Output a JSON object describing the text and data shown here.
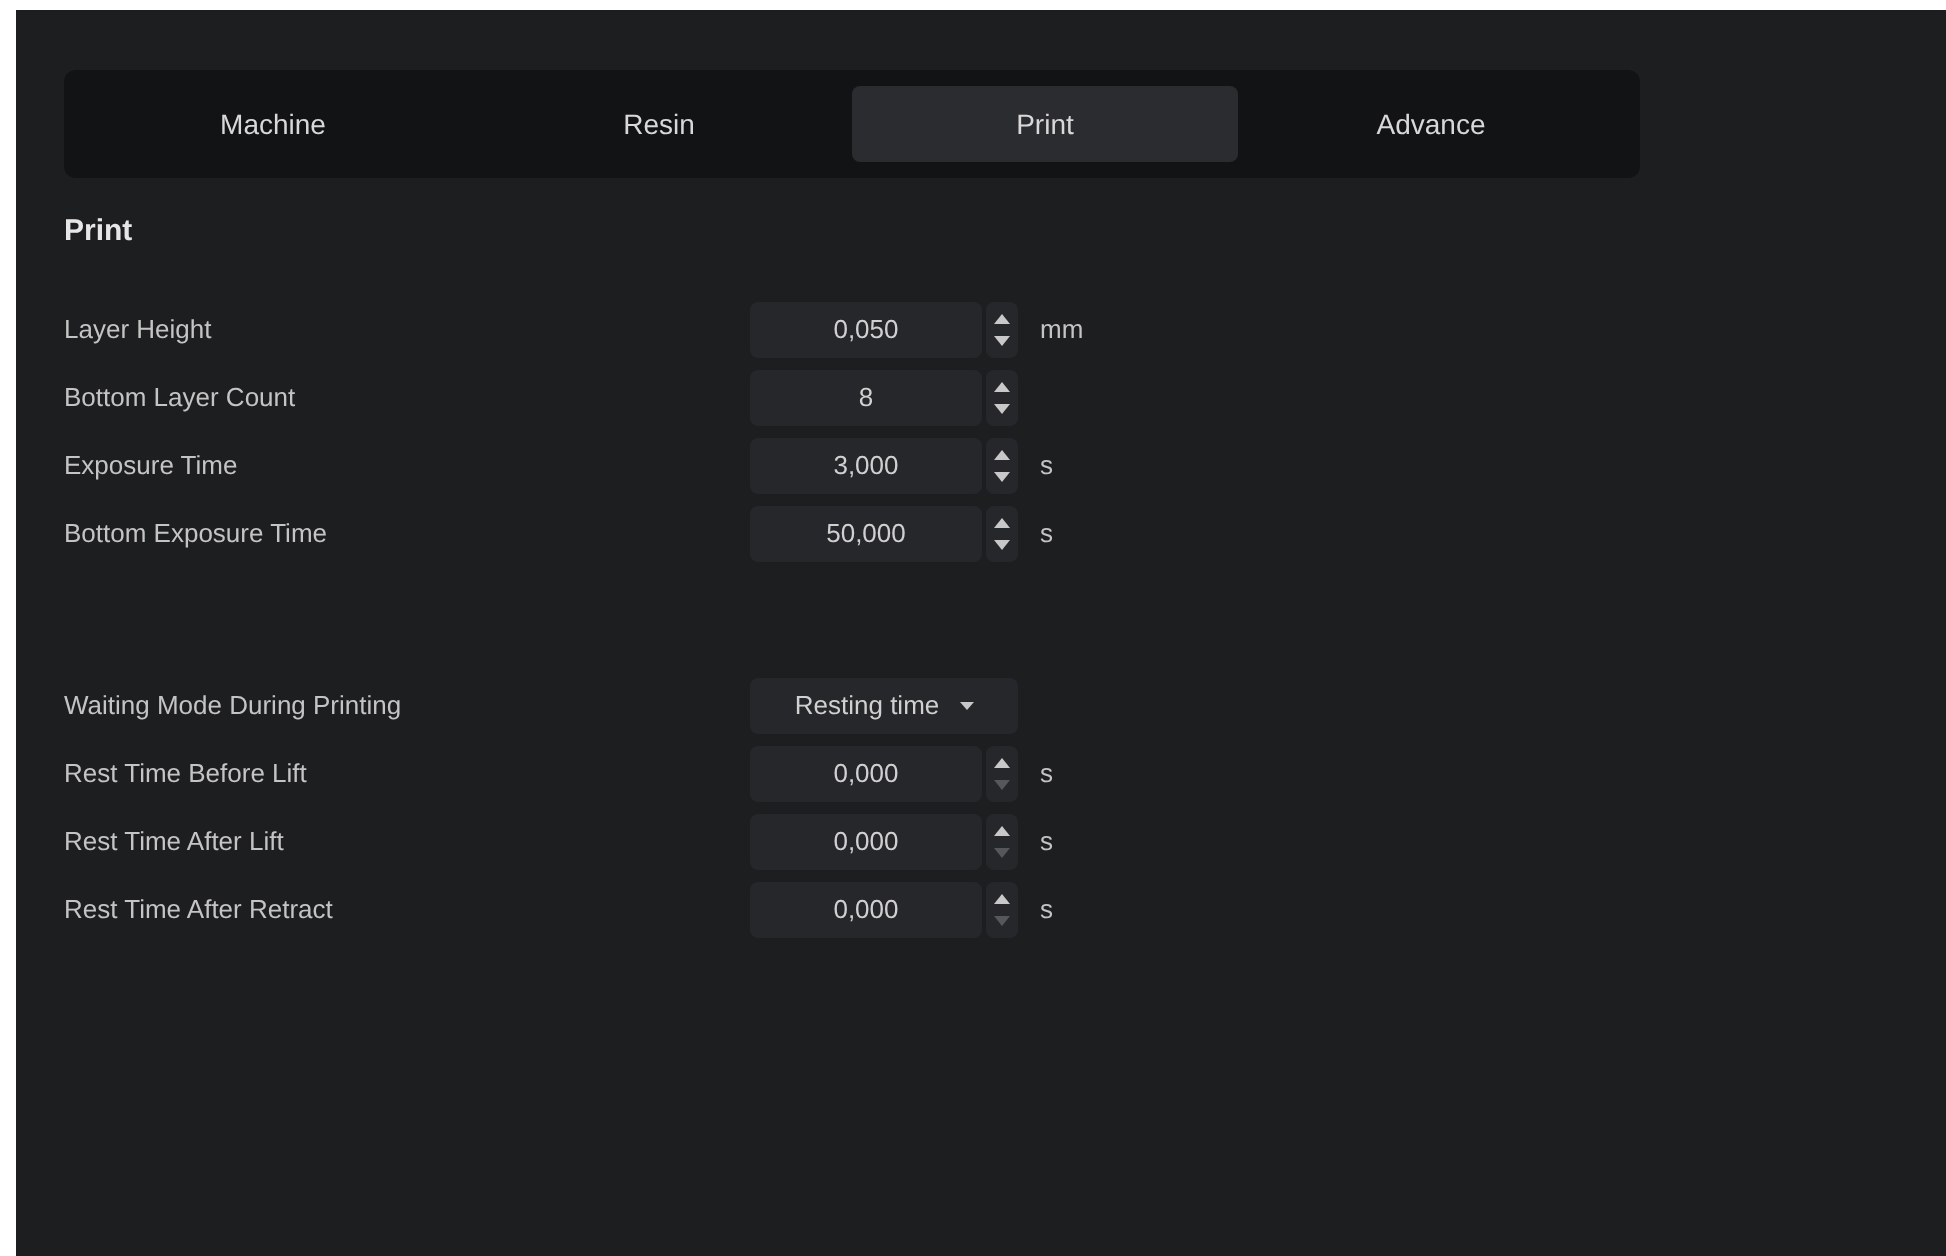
{
  "tabs": [
    {
      "label": "Machine",
      "selected": false
    },
    {
      "label": "Resin",
      "selected": false
    },
    {
      "label": "Print",
      "selected": true
    },
    {
      "label": "Advance",
      "selected": false
    }
  ],
  "section_title": "Print",
  "groups": [
    {
      "rows": [
        {
          "kind": "spin",
          "label": "Layer Height",
          "value": "0,050",
          "unit": "mm",
          "down_disabled": false
        },
        {
          "kind": "spin",
          "label": "Bottom Layer Count",
          "value": "8",
          "down_disabled": false
        },
        {
          "kind": "spin",
          "label": "Exposure Time",
          "value": "3,000",
          "unit": "s",
          "down_disabled": false
        },
        {
          "kind": "spin",
          "label": "Bottom Exposure Time",
          "value": "50,000",
          "unit": "s",
          "down_disabled": false
        }
      ]
    },
    {
      "rows": [
        {
          "kind": "dropdown",
          "label": "Waiting Mode During Printing",
          "value": "Resting time"
        },
        {
          "kind": "spin",
          "label": "Rest Time Before Lift",
          "value": "0,000",
          "unit": "s",
          "down_disabled": true
        },
        {
          "kind": "spin",
          "label": "Rest Time After Lift",
          "value": "0,000",
          "unit": "s",
          "down_disabled": true
        },
        {
          "kind": "spin",
          "label": "Rest Time After Retract",
          "value": "0,000",
          "unit": "s",
          "down_disabled": true
        }
      ]
    }
  ]
}
